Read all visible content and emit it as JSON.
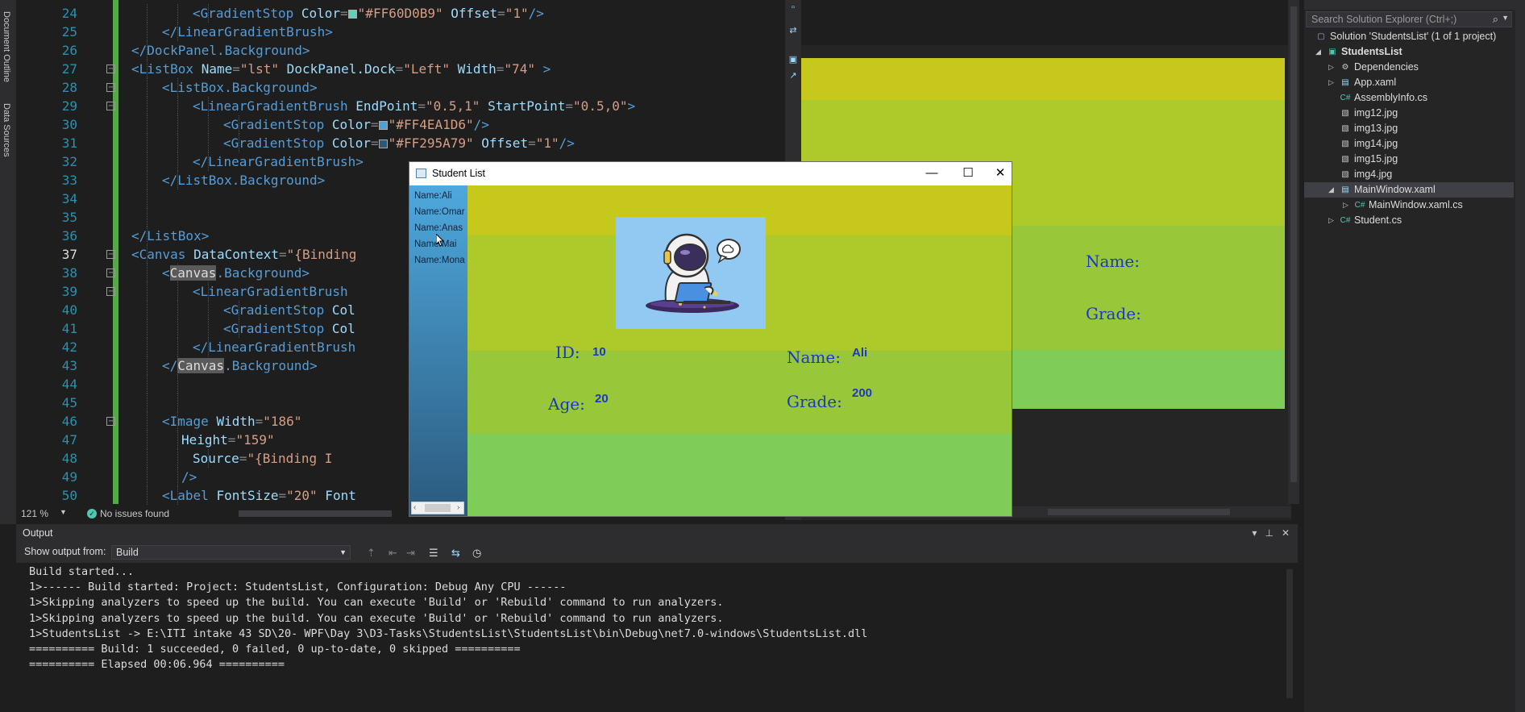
{
  "left_strip": {
    "tabs": [
      "Document Outline",
      "Data Sources"
    ]
  },
  "editor": {
    "lines": [
      {
        "n": "24",
        "html": "<span class='t'>&lt;GradientStop </span><span class='a'>Color</span><span class='p'>=</span><span class='sw' style='background:#60d0b9'></span><span class='s'>\"#FF60D0B9\"</span><span class='a'> Offset</span><span class='p'>=</span><span class='s'>\"1\"</span><span class='t'>/&gt;</span>"
      },
      {
        "n": "25",
        "html": "<span class='t'>&lt;/LinearGradientBrush&gt;</span>"
      },
      {
        "n": "26",
        "html": "<span class='t'>&lt;/DockPanel.Background&gt;</span>"
      },
      {
        "n": "27",
        "html": "<span class='t'>&lt;ListBox </span><span class='a'>Name</span><span class='p'>=</span><span class='s'>\"lst\"</span><span class='a'> DockPanel.Dock</span><span class='p'>=</span><span class='s'>\"Left\"</span><span class='a'> Width</span><span class='p'>=</span><span class='s'>\"74\"</span><span class='t'> &gt;</span>"
      },
      {
        "n": "28",
        "html": "<span class='t'>&lt;ListBox.Background&gt;</span>"
      },
      {
        "n": "29",
        "html": "<span class='t'>&lt;LinearGradientBrush </span><span class='a'>EndPoint</span><span class='p'>=</span><span class='s'>\"0.5,1\"</span><span class='a'> StartPoint</span><span class='p'>=</span><span class='s'>\"0.5,0\"</span><span class='t'>&gt;</span>"
      },
      {
        "n": "30",
        "html": "<span class='t'>&lt;GradientStop </span><span class='a'>Color</span><span class='p'>=</span><span class='sw' style='background:#4ea1d6'></span><span class='s'>\"#FF4EA1D6\"</span><span class='t'>/&gt;</span>"
      },
      {
        "n": "31",
        "html": "<span class='t'>&lt;GradientStop </span><span class='a'>Color</span><span class='p'>=</span><span class='sw' style='background:#295a79'></span><span class='s'>\"#FF295A79\"</span><span class='a'> Offset</span><span class='p'>=</span><span class='s'>\"1\"</span><span class='t'>/&gt;</span>"
      },
      {
        "n": "32",
        "html": "<span class='t'>&lt;/LinearGradientBrush&gt;</span>"
      },
      {
        "n": "33",
        "html": "<span class='t'>&lt;/ListBox.Background&gt;</span>"
      },
      {
        "n": "34",
        "html": ""
      },
      {
        "n": "35",
        "html": ""
      },
      {
        "n": "36",
        "html": "<span class='t'>&lt;/ListBox&gt;</span>"
      },
      {
        "n": "37",
        "html": "<span class='t'>&lt;Canvas </span><span class='a'>DataContext</span><span class='p'>=</span><span class='s'>\"{Binding</span>"
      },
      {
        "n": "38",
        "html": "<span class='t'>&lt;</span><span class='hl'>Canvas</span><span class='t'>.Background&gt;</span>"
      },
      {
        "n": "39",
        "html": "<span class='t'>&lt;LinearGradientBrush</span>"
      },
      {
        "n": "40",
        "html": "<span class='t'>&lt;GradientStop </span><span class='a'>Col</span>"
      },
      {
        "n": "41",
        "html": "<span class='t'>&lt;GradientStop </span><span class='a'>Col</span>"
      },
      {
        "n": "42",
        "html": "<span class='t'>&lt;/LinearGradientBrush</span>"
      },
      {
        "n": "43",
        "html": "<span class='t'>&lt;/</span><span class='hl'>Canvas</span><span class='t'>.Background&gt;</span>"
      },
      {
        "n": "44",
        "html": ""
      },
      {
        "n": "45",
        "html": ""
      },
      {
        "n": "46",
        "html": "<span class='t'>&lt;Image </span><span class='a'>Width</span><span class='p'>=</span><span class='s'>\"186\"</span>"
      },
      {
        "n": "47",
        "html": "<span class='a'>Height</span><span class='p'>=</span><span class='s'>\"159\"</span>"
      },
      {
        "n": "48",
        "html": "<span class='a'>Source</span><span class='p'>=</span><span class='s'>\"{Binding I</span>"
      },
      {
        "n": "49",
        "html": "<span class='t'>/&gt;</span>"
      },
      {
        "n": "50",
        "html": "<span class='t'>&lt;Label </span><span class='a'>FontSize</span><span class='p'>=</span><span class='s'>\"20\"</span><span class='a'> Font</span>"
      }
    ],
    "zoom": "121 %",
    "issues": "No issues found"
  },
  "designer": {
    "name_label": "Name:",
    "grade_label": "Grade:"
  },
  "solution_explorer": {
    "search_placeholder": "Search Solution Explorer (Ctrl+;)",
    "items": [
      {
        "label": "Solution 'StudentsList' (1 of 1 project)",
        "icon": "solution-icon"
      },
      {
        "label": "StudentsList",
        "icon": "csharp-project-icon"
      },
      {
        "label": "Dependencies",
        "icon": "dependencies-icon"
      },
      {
        "label": "App.xaml",
        "icon": "xaml-file-icon"
      },
      {
        "label": "AssemblyInfo.cs",
        "icon": "csharp-file-icon"
      },
      {
        "label": "img12.jpg",
        "icon": "image-file-icon"
      },
      {
        "label": "img13.jpg",
        "icon": "image-file-icon"
      },
      {
        "label": "img14.jpg",
        "icon": "image-file-icon"
      },
      {
        "label": "img15.jpg",
        "icon": "image-file-icon"
      },
      {
        "label": "img4.jpg",
        "icon": "image-file-icon"
      },
      {
        "label": "MainWindow.xaml",
        "icon": "xaml-file-icon"
      },
      {
        "label": "MainWindow.xaml.cs",
        "icon": "csharp-file-icon"
      },
      {
        "label": "Student.cs",
        "icon": "csharp-file-icon"
      }
    ]
  },
  "output": {
    "title": "Output",
    "show_from_label": "Show output from:",
    "source": "Build",
    "lines": [
      "Build started...",
      "1>------ Build started: Project: StudentsList, Configuration: Debug Any CPU ------",
      "1>Skipping analyzers to speed up the build. You can execute 'Build' or 'Rebuild' command to run analyzers.",
      "1>Skipping analyzers to speed up the build. You can execute 'Build' or 'Rebuild' command to run analyzers.",
      "1>StudentsList -> E:\\ITI intake 43 SD\\20- WPF\\Day 3\\D3-Tasks\\StudentsList\\StudentsList\\bin\\Debug\\net7.0-windows\\StudentsList.dll",
      "========== Build: 1 succeeded, 0 failed, 0 up-to-date, 0 skipped ==========",
      "========== Elapsed 00:06.964 =========="
    ]
  },
  "app_window": {
    "title": "Student List",
    "list_items": [
      "Name:Ali",
      "Name:Omar",
      "Name:Anas",
      "Name:Mai",
      "Name:Mona"
    ],
    "id_label": "ID:",
    "id_value": "10",
    "name_label": "Name:",
    "name_value": "Ali",
    "age_label": "Age:",
    "age_value": "20",
    "grade_label": "Grade:",
    "grade_value": "200"
  }
}
